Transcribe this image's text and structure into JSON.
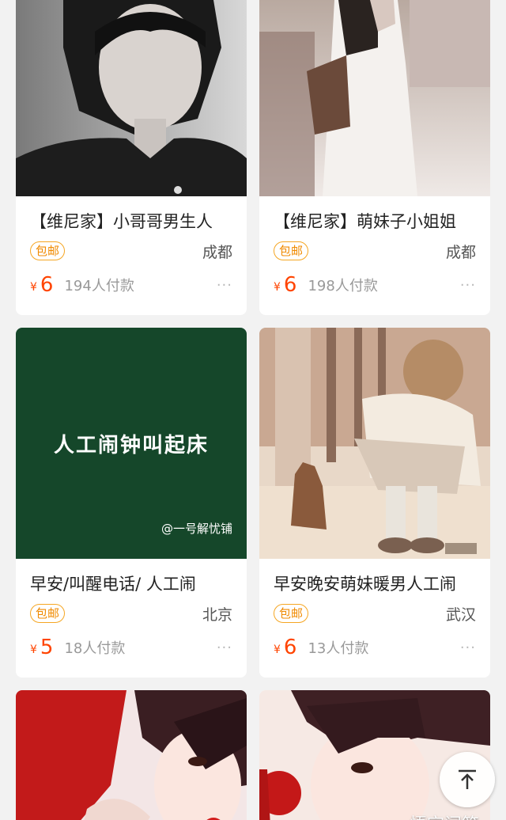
{
  "products": [
    {
      "title": "【维尼家】小哥哥男生人",
      "badge": "包邮",
      "city": "成都",
      "currency": "¥",
      "price": "6",
      "sold": "194人付款",
      "more": "···"
    },
    {
      "title": "【维尼家】萌妹子小姐姐",
      "badge": "包邮",
      "city": "成都",
      "currency": "¥",
      "price": "6",
      "sold": "198人付款",
      "more": "···"
    },
    {
      "title": "早安/叫醒电话/ 人工闹",
      "badge": "包邮",
      "city": "北京",
      "currency": "¥",
      "price": "5",
      "sold": "18人付款",
      "more": "···",
      "image_text": "人工闹钟叫起床",
      "image_caption": "@一号解忧铺"
    },
    {
      "title": "早安晚安萌妹暖男人工闹",
      "badge": "包邮",
      "city": "武汉",
      "currency": "¥",
      "price": "6",
      "sold": "13人付款",
      "more": "···"
    }
  ],
  "back_to_top_icon": "arrow-up-to-top-icon",
  "watermark": "悟空问答",
  "colors": {
    "price": "#ff4400",
    "badge": "#f5a623",
    "green_bg": "#15472a"
  }
}
